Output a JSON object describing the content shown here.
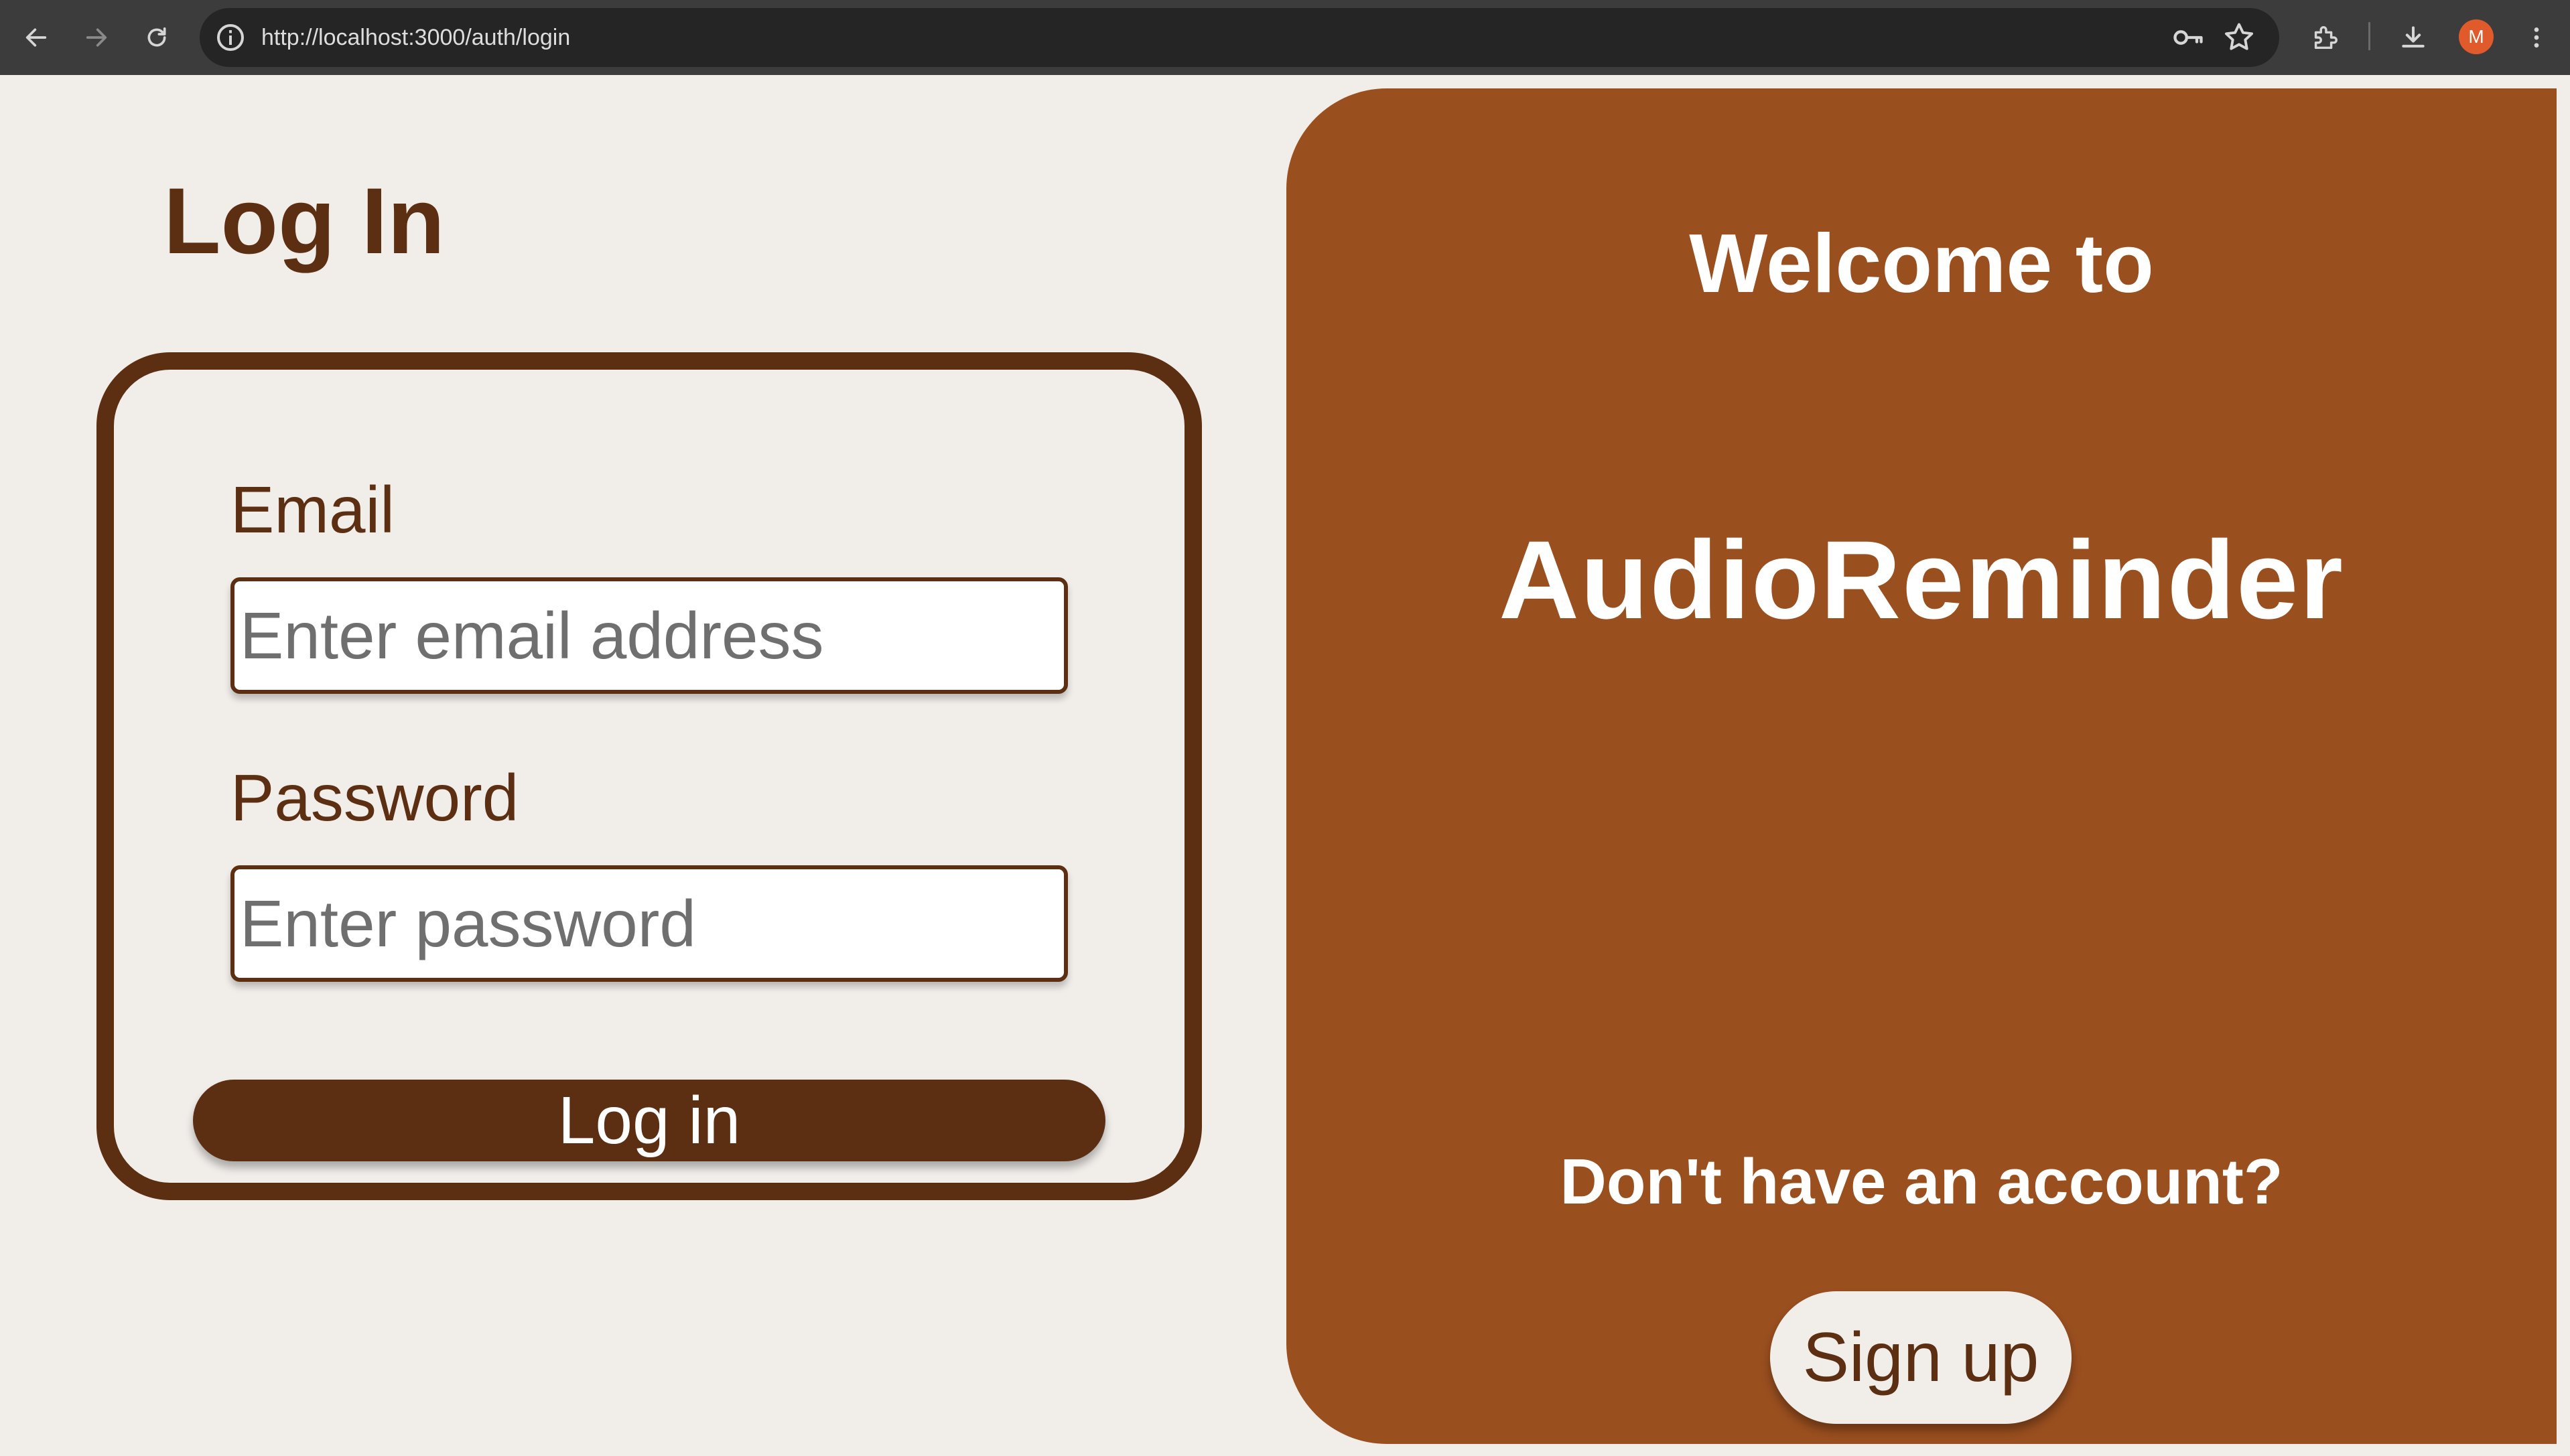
{
  "browser": {
    "url": "http://localhost:3000/auth/login",
    "avatar_initial": "M",
    "icons": [
      "back-arrow-icon",
      "forward-arrow-icon",
      "reload-icon",
      "site-info-icon",
      "password-key-icon",
      "bookmark-star-icon",
      "extensions-icon",
      "download-icon",
      "more-menu-icon"
    ]
  },
  "login": {
    "title": "Log In",
    "email_label": "Email",
    "email_placeholder": "Enter email address",
    "email_value": "",
    "password_label": "Password",
    "password_placeholder": "Enter password",
    "password_value": "",
    "submit_label": "Log in"
  },
  "welcome": {
    "line1": "Welcome to",
    "app_name": "AudioReminder",
    "prompt": "Don't have an account?",
    "signup_label": "Sign up"
  },
  "colors": {
    "primary_brown": "#5c2e12",
    "panel_rust": "#9a4f1f",
    "background": "#f1eeea"
  }
}
